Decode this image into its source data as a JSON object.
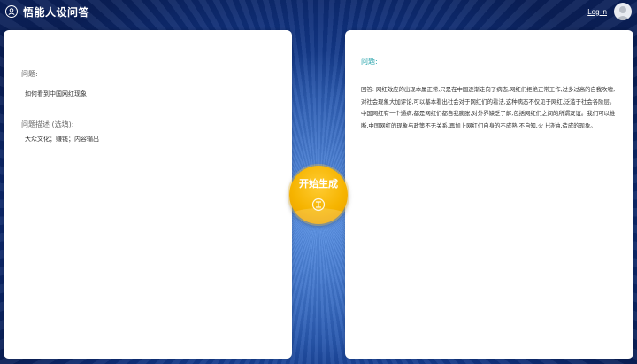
{
  "header": {
    "title": "悟能人设问答",
    "login_label": "Log in"
  },
  "left_panel": {
    "question_label": "问题:",
    "question_value": "如何看到中国网红现象",
    "description_label": "问题描述 (选填):",
    "description_value": "大众文化；赚钱；内容输出"
  },
  "generate_button": {
    "label": "开始生成"
  },
  "right_panel": {
    "title": "问题:",
    "answer": "回答: 网红效应的出现本属正常,只是在中国逐渐走向了病态,网红们拒绝正常工作,过多过高的自我吹嘘,对社会现象大加评论,可以基本看出社会对于网红们的看法,这种病态不仅见于网红,泛滥于社会各阶层。中国网红有一个通病,都是网红们都自我膨胀,对外界缺乏了解,包括网红们之间的所谓友谊。我们可以推断,中国网红的现象与政策不无关系,再加上网红们自身的不成熟,不自知,火上浇油,造成的现象。"
  },
  "icons": {
    "brand": "person-circle-icon",
    "avatar": "user-avatar-icon",
    "generate": "wu-logo-icon"
  },
  "colors": {
    "background": "#1b4aa3",
    "accent_button": "#f6b400",
    "answer_title": "#20a0a8"
  }
}
